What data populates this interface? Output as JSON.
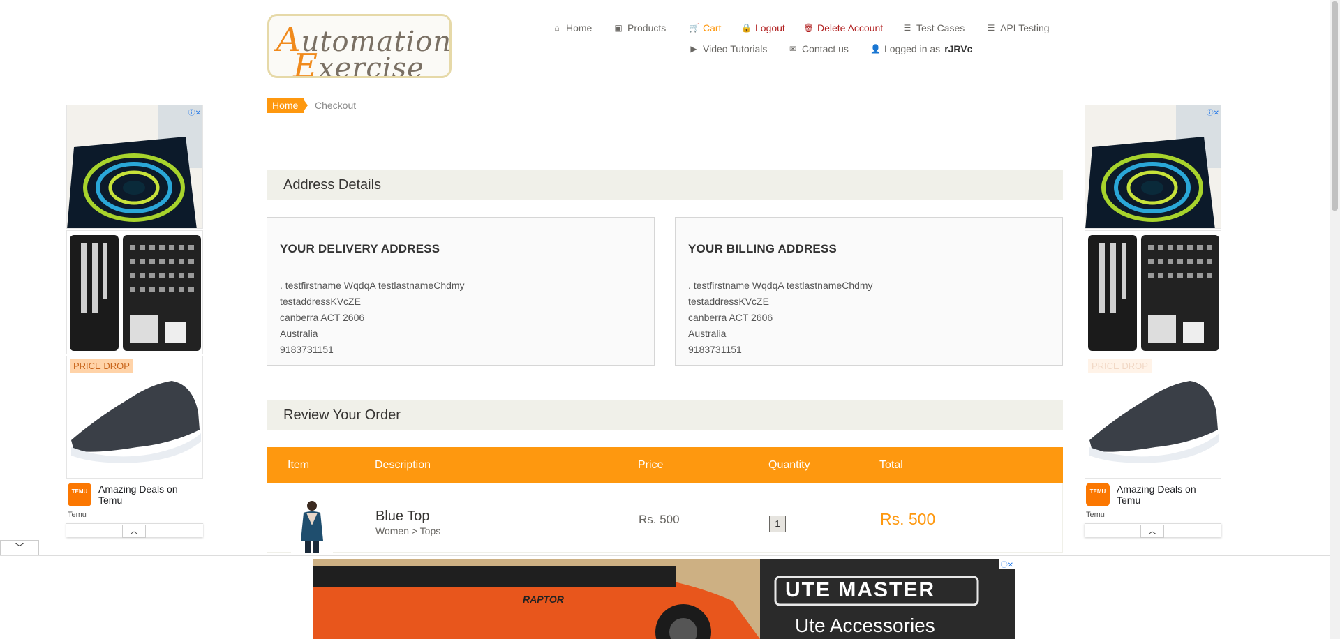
{
  "logo": {
    "line1_cap": "A",
    "line1_rest": "utomation",
    "line2_cap": "E",
    "line2_rest": "xercise"
  },
  "nav": {
    "home": "Home",
    "products": "Products",
    "cart": "Cart",
    "logout": "Logout",
    "delete_account": "Delete Account",
    "test_cases": "Test Cases",
    "api_testing": "API Testing",
    "video_tutorials": "Video Tutorials",
    "contact_us": "Contact us",
    "logged_in_prefix": "Logged in as",
    "username": "rJRVc"
  },
  "breadcrumb": {
    "home": "Home",
    "current": "Checkout"
  },
  "address_section": {
    "title": "Address Details"
  },
  "delivery": {
    "title": "YOUR DELIVERY ADDRESS",
    "name": ". testfirstname WqdqA testlastnameChdmy",
    "address": "testaddressKVcZE",
    "city_state_zip": "canberra ACT 2606",
    "country": "Australia",
    "phone": "9183731151"
  },
  "billing": {
    "title": "YOUR BILLING ADDRESS",
    "name": ". testfirstname WqdqA testlastnameChdmy",
    "address": "testaddressKVcZE",
    "city_state_zip": "canberra ACT 2606",
    "country": "Australia",
    "phone": "9183731151"
  },
  "review_section": {
    "title": "Review Your Order"
  },
  "table": {
    "headers": {
      "item": "Item",
      "description": "Description",
      "price": "Price",
      "quantity": "Quantity",
      "total": "Total"
    },
    "rows": [
      {
        "name": "Blue Top",
        "category": "Women > Tops",
        "price": "Rs. 500",
        "quantity": "1",
        "total": "Rs. 500"
      }
    ]
  },
  "ads": {
    "price_drop": "PRICE DROP",
    "deal_text": "Amazing Deals on Temu",
    "deal_source": "Temu",
    "temu_logo_text": "TEMU",
    "banner_brand": "UTE MASTER",
    "banner_tagline": "Ute Accessories",
    "truck_badge": "RAPTOR"
  },
  "colors": {
    "accent": "#fe980f",
    "danger": "#b11f1f",
    "section_bg": "#f0f0e9",
    "text": "#696763"
  }
}
